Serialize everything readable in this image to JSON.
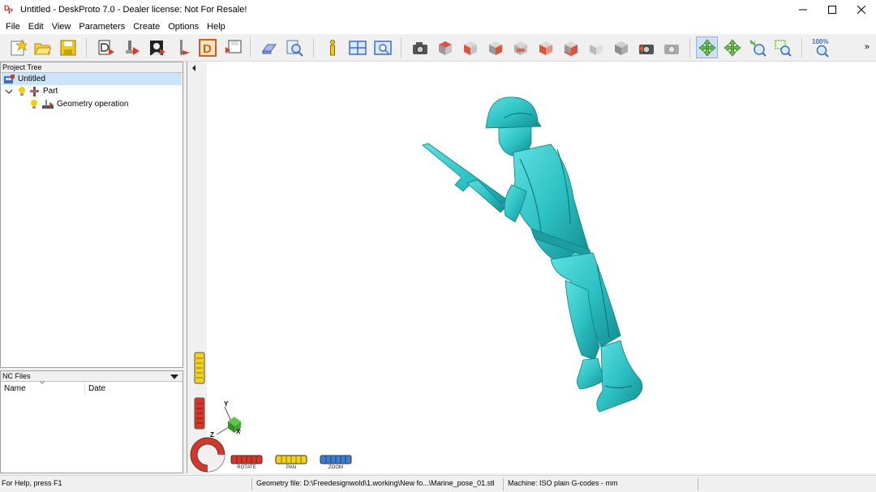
{
  "window": {
    "title": "Untitled - DeskProto 7.0 - Dealer license: Not For Resale!",
    "app_icon_text": "DP"
  },
  "menu": [
    "File",
    "Edit",
    "View",
    "Parameters",
    "Create",
    "Options",
    "Help"
  ],
  "toolbar": {
    "zoom_level": "100%",
    "more": "»"
  },
  "project_tree": {
    "title": "Project Tree",
    "items": [
      {
        "label": "Untitled",
        "icon": "project-icon"
      },
      {
        "label": "Part",
        "icon": "part-icon"
      },
      {
        "label": "Geometry operation",
        "icon": "operation-icon"
      }
    ]
  },
  "nc_files": {
    "title": "NC Files",
    "columns": [
      "Name",
      "Date"
    ]
  },
  "viewport": {
    "model_color": "#33cccc",
    "axes": {
      "x": "X",
      "y": "Y",
      "z": "Z"
    },
    "dials": [
      "ROTATE",
      "PAN",
      "ZOOM"
    ]
  },
  "status": {
    "help": "For Help, press F1",
    "geometry_file": "Geometry file: D:\\Freedesignwold\\1.working\\New fo...\\Marine_pose_01.stl",
    "machine": "Machine: ISO plain G-codes - mm"
  }
}
